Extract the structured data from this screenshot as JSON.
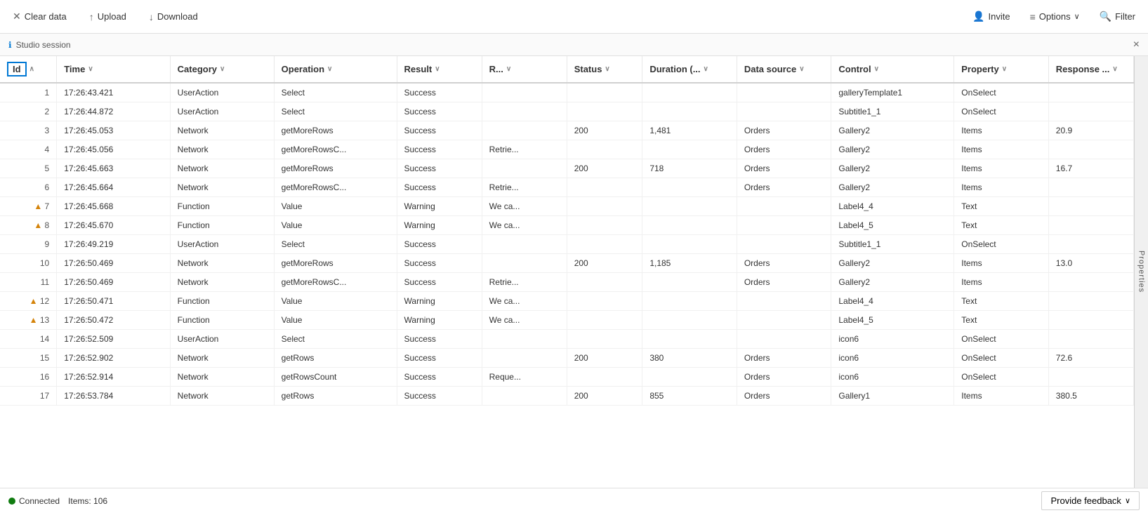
{
  "toolbar": {
    "clear_data": "Clear data",
    "upload": "Upload",
    "download": "Download",
    "invite": "Invite",
    "options": "Options",
    "filter": "Filter"
  },
  "session": {
    "label": "Studio session",
    "close": "×"
  },
  "columns": [
    {
      "key": "id",
      "label": "Id",
      "sorted": true
    },
    {
      "key": "time",
      "label": "Time"
    },
    {
      "key": "category",
      "label": "Category"
    },
    {
      "key": "operation",
      "label": "Operation"
    },
    {
      "key": "result",
      "label": "Result"
    },
    {
      "key": "r",
      "label": "R..."
    },
    {
      "key": "status",
      "label": "Status"
    },
    {
      "key": "duration",
      "label": "Duration (..."
    },
    {
      "key": "datasource",
      "label": "Data source"
    },
    {
      "key": "control",
      "label": "Control"
    },
    {
      "key": "property",
      "label": "Property"
    },
    {
      "key": "response",
      "label": "Response ..."
    }
  ],
  "rows": [
    {
      "id": 1,
      "warning": false,
      "time": "17:26:43.421",
      "category": "UserAction",
      "operation": "Select",
      "result": "Success",
      "r": "",
      "status": "",
      "duration": "",
      "datasource": "",
      "control": "galleryTemplate1",
      "property": "OnSelect",
      "response": ""
    },
    {
      "id": 2,
      "warning": false,
      "time": "17:26:44.872",
      "category": "UserAction",
      "operation": "Select",
      "result": "Success",
      "r": "",
      "status": "",
      "duration": "",
      "datasource": "",
      "control": "Subtitle1_1",
      "property": "OnSelect",
      "response": ""
    },
    {
      "id": 3,
      "warning": false,
      "time": "17:26:45.053",
      "category": "Network",
      "operation": "getMoreRows",
      "result": "Success",
      "r": "",
      "status": "200",
      "duration": "1,481",
      "datasource": "Orders",
      "control": "Gallery2",
      "property": "Items",
      "response": "20.9"
    },
    {
      "id": 4,
      "warning": false,
      "time": "17:26:45.056",
      "category": "Network",
      "operation": "getMoreRowsC...",
      "result": "Success",
      "r": "Retrie...",
      "status": "",
      "duration": "",
      "datasource": "Orders",
      "control": "Gallery2",
      "property": "Items",
      "response": ""
    },
    {
      "id": 5,
      "warning": false,
      "time": "17:26:45.663",
      "category": "Network",
      "operation": "getMoreRows",
      "result": "Success",
      "r": "",
      "status": "200",
      "duration": "718",
      "datasource": "Orders",
      "control": "Gallery2",
      "property": "Items",
      "response": "16.7"
    },
    {
      "id": 6,
      "warning": false,
      "time": "17:26:45.664",
      "category": "Network",
      "operation": "getMoreRowsC...",
      "result": "Success",
      "r": "Retrie...",
      "status": "",
      "duration": "",
      "datasource": "Orders",
      "control": "Gallery2",
      "property": "Items",
      "response": ""
    },
    {
      "id": 7,
      "warning": true,
      "time": "17:26:45.668",
      "category": "Function",
      "operation": "Value",
      "result": "Warning",
      "r": "We ca...",
      "status": "",
      "duration": "",
      "datasource": "",
      "control": "Label4_4",
      "property": "Text",
      "response": ""
    },
    {
      "id": 8,
      "warning": true,
      "time": "17:26:45.670",
      "category": "Function",
      "operation": "Value",
      "result": "Warning",
      "r": "We ca...",
      "status": "",
      "duration": "",
      "datasource": "",
      "control": "Label4_5",
      "property": "Text",
      "response": ""
    },
    {
      "id": 9,
      "warning": false,
      "time": "17:26:49.219",
      "category": "UserAction",
      "operation": "Select",
      "result": "Success",
      "r": "",
      "status": "",
      "duration": "",
      "datasource": "",
      "control": "Subtitle1_1",
      "property": "OnSelect",
      "response": ""
    },
    {
      "id": 10,
      "warning": false,
      "time": "17:26:50.469",
      "category": "Network",
      "operation": "getMoreRows",
      "result": "Success",
      "r": "",
      "status": "200",
      "duration": "1,185",
      "datasource": "Orders",
      "control": "Gallery2",
      "property": "Items",
      "response": "13.0"
    },
    {
      "id": 11,
      "warning": false,
      "time": "17:26:50.469",
      "category": "Network",
      "operation": "getMoreRowsC...",
      "result": "Success",
      "r": "Retrie...",
      "status": "",
      "duration": "",
      "datasource": "Orders",
      "control": "Gallery2",
      "property": "Items",
      "response": ""
    },
    {
      "id": 12,
      "warning": true,
      "time": "17:26:50.471",
      "category": "Function",
      "operation": "Value",
      "result": "Warning",
      "r": "We ca...",
      "status": "",
      "duration": "",
      "datasource": "",
      "control": "Label4_4",
      "property": "Text",
      "response": ""
    },
    {
      "id": 13,
      "warning": true,
      "time": "17:26:50.472",
      "category": "Function",
      "operation": "Value",
      "result": "Warning",
      "r": "We ca...",
      "status": "",
      "duration": "",
      "datasource": "",
      "control": "Label4_5",
      "property": "Text",
      "response": ""
    },
    {
      "id": 14,
      "warning": false,
      "time": "17:26:52.509",
      "category": "UserAction",
      "operation": "Select",
      "result": "Success",
      "r": "",
      "status": "",
      "duration": "",
      "datasource": "",
      "control": "icon6",
      "property": "OnSelect",
      "response": ""
    },
    {
      "id": 15,
      "warning": false,
      "time": "17:26:52.902",
      "category": "Network",
      "operation": "getRows",
      "result": "Success",
      "r": "",
      "status": "200",
      "duration": "380",
      "datasource": "Orders",
      "control": "icon6",
      "property": "OnSelect",
      "response": "72.6"
    },
    {
      "id": 16,
      "warning": false,
      "time": "17:26:52.914",
      "category": "Network",
      "operation": "getRowsCount",
      "result": "Success",
      "r": "Reque...",
      "status": "",
      "duration": "",
      "datasource": "Orders",
      "control": "icon6",
      "property": "OnSelect",
      "response": ""
    },
    {
      "id": 17,
      "warning": false,
      "time": "17:26:53.784",
      "category": "Network",
      "operation": "getRows",
      "result": "Success",
      "r": "",
      "status": "200",
      "duration": "855",
      "datasource": "Orders",
      "control": "Gallery1",
      "property": "Items",
      "response": "380.5"
    }
  ],
  "status": {
    "connected": "Connected",
    "items": "Items: 106"
  },
  "feedback": {
    "label": "Provide feedback"
  },
  "right_panel": {
    "label": "Properties"
  }
}
